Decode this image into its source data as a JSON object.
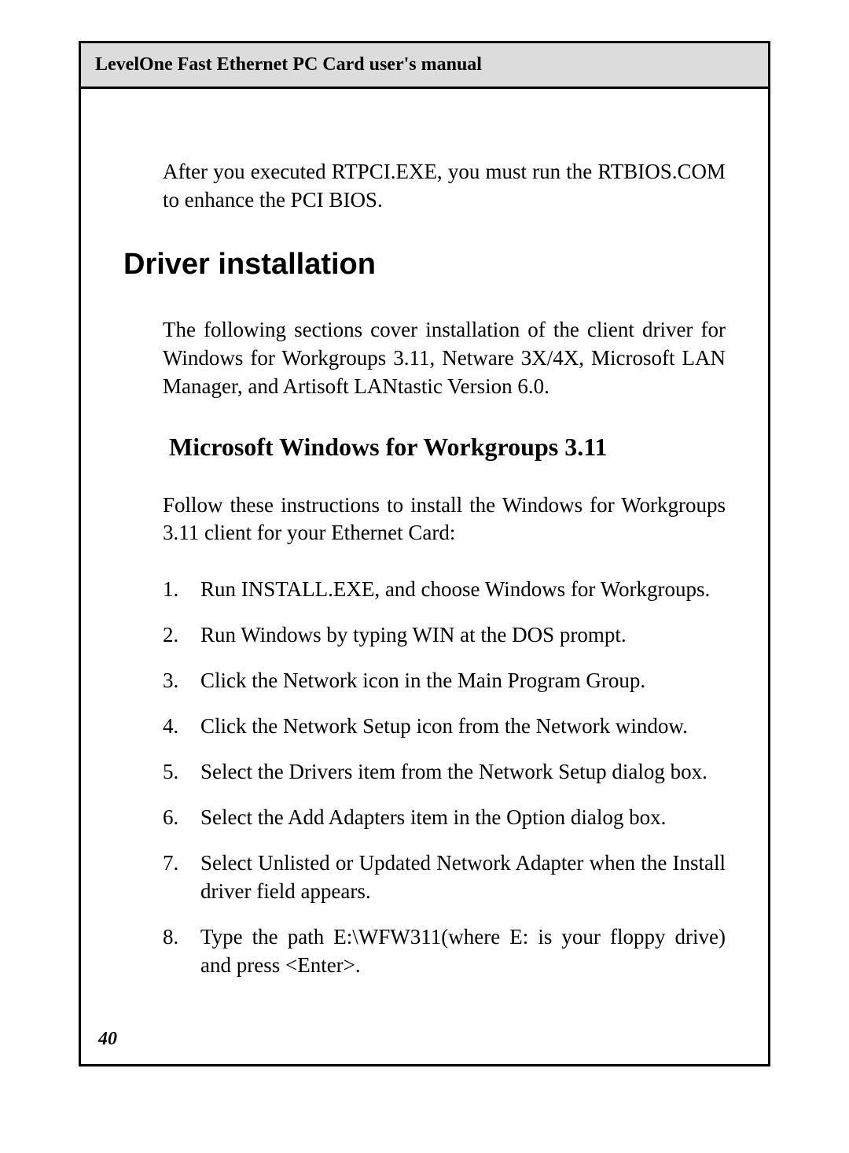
{
  "header": {
    "title": "LevelOne Fast Ethernet PC Card user's manual"
  },
  "content": {
    "intro_paragraph": "After you executed RTPCI.EXE, you must run the RTBIOS.COM to enhance the PCI BIOS.",
    "section_heading": "Driver installation",
    "section_paragraph": "The following sections cover installation of the client driver for Windows for Workgroups 3.11, Netware 3X/4X, Microsoft LAN Manager, and Artisoft LANtastic Version 6.0.",
    "subsection_heading": "Microsoft Windows for Workgroups 3.11",
    "subsection_paragraph": "Follow these instructions to install the Windows for Workgroups 3.11 client for your Ethernet Card:",
    "instructions": [
      "Run INSTALL.EXE, and choose Windows for Workgroups.",
      "Run Windows by typing WIN at the DOS prompt.",
      "Click the Network icon in the Main Program Group.",
      "Click the Network Setup icon from the Network window.",
      "Select the Drivers item from the Network Setup dialog box.",
      "Select the Add Adapters item in the Option dialog box.",
      "Select Unlisted or Updated Network Adapter when the Install driver field appears.",
      "Type the path E:\\WFW311(where E: is your floppy drive) and press <Enter>."
    ]
  },
  "footer": {
    "page_number": "40"
  }
}
